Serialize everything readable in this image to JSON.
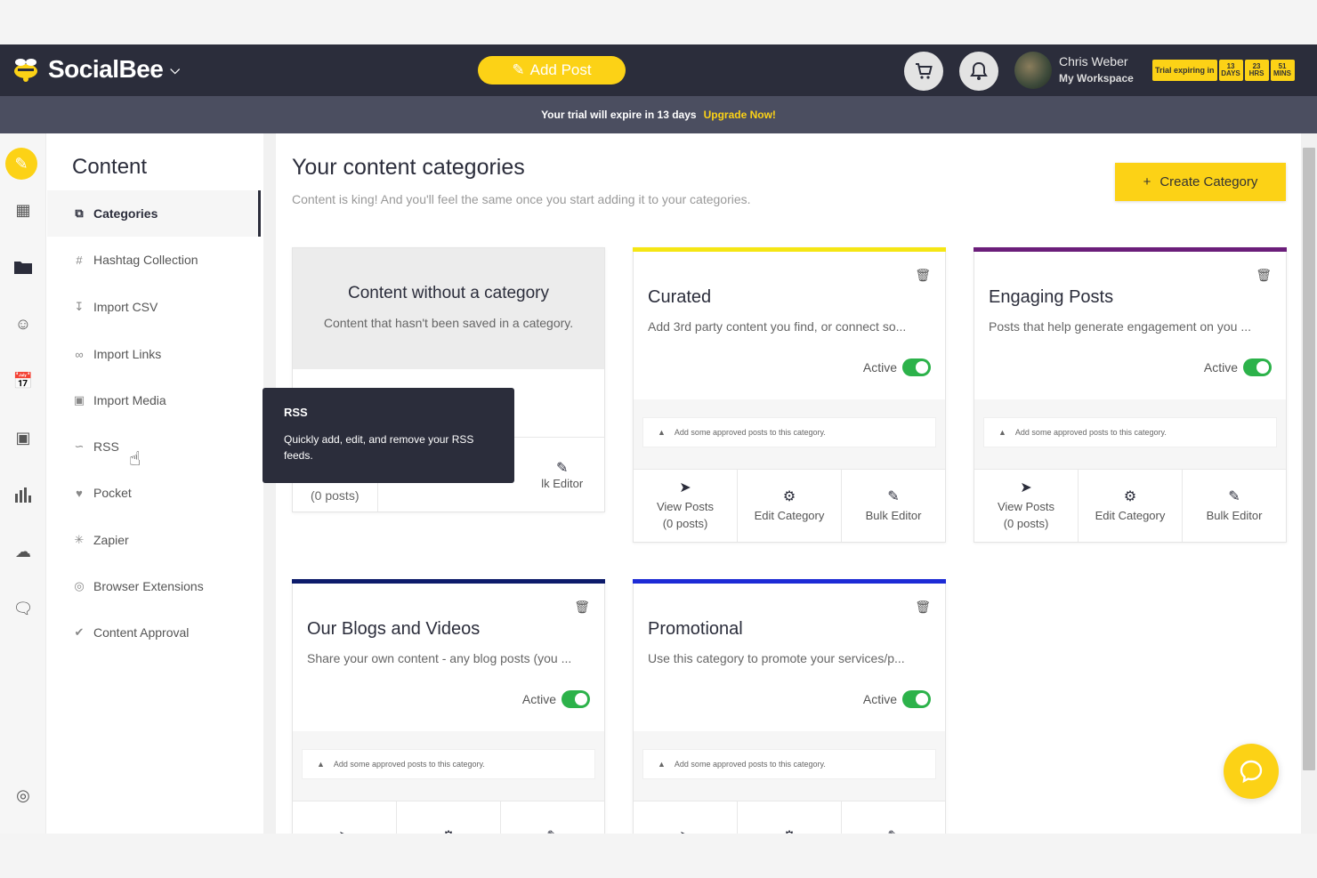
{
  "app": {
    "name": "SocialBee"
  },
  "topbar": {
    "add_post_label": "Add Post",
    "user_name": "Chris Weber",
    "workspace": "My Workspace",
    "trial_label": "Trial expiring in",
    "trial_days": "13",
    "trial_days_unit": "DAYS",
    "trial_hrs": "23",
    "trial_hrs_unit": "HRS",
    "trial_mins": "51",
    "trial_mins_unit": "MINS"
  },
  "banner": {
    "text": "Your trial will expire in 13 days",
    "cta": "Upgrade Now!"
  },
  "sidebar": {
    "title": "Content",
    "items": [
      {
        "label": "Categories"
      },
      {
        "label": "Hashtag Collection"
      },
      {
        "label": "Import CSV"
      },
      {
        "label": "Import Links"
      },
      {
        "label": "Import Media"
      },
      {
        "label": "RSS"
      },
      {
        "label": "Pocket"
      },
      {
        "label": "Zapier"
      },
      {
        "label": "Browser Extensions"
      },
      {
        "label": "Content Approval"
      }
    ]
  },
  "main": {
    "title": "Your content categories",
    "subtitle": "Content is king! And you'll feel the same once you start adding it to your categories.",
    "create_label": "Create Category"
  },
  "tooltip": {
    "title": "RSS",
    "text": "Quickly add, edit, and remove your RSS feeds."
  },
  "cards": [
    {
      "title": "Content without a category",
      "desc": "Content that hasn't been saved in a category.",
      "posts": "(0 posts)",
      "bulk": "lk Editor"
    },
    {
      "title": "Curated",
      "desc": "Add 3rd party content you find, or connect so...",
      "status": "Active",
      "hint": "Add some approved posts to this category.",
      "view": "View Posts",
      "posts": "(0 posts)",
      "edit": "Edit Category",
      "bulk": "Bulk Editor",
      "color": "#f5e614"
    },
    {
      "title": "Engaging Posts",
      "desc": "Posts that help generate engagement on you ...",
      "status": "Active",
      "hint": "Add some approved posts to this category.",
      "view": "View Posts",
      "posts": "(0 posts)",
      "edit": "Edit Category",
      "bulk": "Bulk Editor",
      "color": "#6b1e7a"
    },
    {
      "title": "Our Blogs and Videos",
      "desc": "Share your own content - any blog posts (you ...",
      "status": "Active",
      "hint": "Add some approved posts to this category.",
      "color": "#0d1b6b"
    },
    {
      "title": "Promotional",
      "desc": "Use this category to promote your services/p...",
      "status": "Active",
      "hint": "Add some approved posts to this category.",
      "color": "#1d2bd6"
    }
  ],
  "colors": {
    "accent": "#fcd216",
    "dark": "#2b2d3b",
    "toggle": "#2cb24a"
  }
}
